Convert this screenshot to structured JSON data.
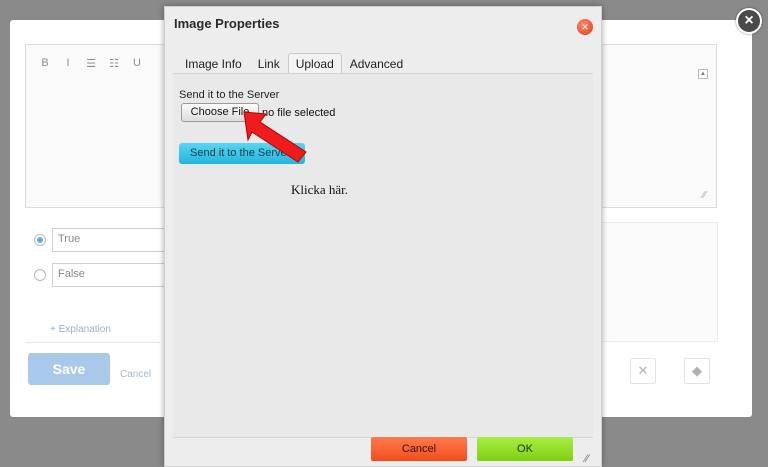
{
  "background_modal": {
    "editor_toolbar": [
      "B",
      "I",
      "☰",
      "☷",
      "U"
    ],
    "answers": [
      {
        "label": "True",
        "selected": true
      },
      {
        "label": "False",
        "selected": false
      }
    ],
    "explanation_link": "+ Explanation",
    "save_label": "Save",
    "cancel_label": "Cancel",
    "close_glyph": "×"
  },
  "dialog": {
    "title": "Image Properties",
    "tabs": [
      {
        "label": "Image Info",
        "active": false
      },
      {
        "label": "Link",
        "active": false
      },
      {
        "label": "Upload",
        "active": true
      },
      {
        "label": "Advanced",
        "active": false
      }
    ],
    "send_to_server_label": "Send it to the Server",
    "choose_file_label": "Choose File",
    "no_file_text": "no file selected",
    "send_button_label": "Send it to the Server",
    "annotation_note": "Klicka här.",
    "cancel_label": "Cancel",
    "ok_label": "OK"
  },
  "colors": {
    "arrow": "#ee1c1c",
    "send_button": "#2ec2e6",
    "cancel_button": "#f4531f",
    "ok_button": "#8ad816",
    "save_button": "#a9c9ea"
  }
}
